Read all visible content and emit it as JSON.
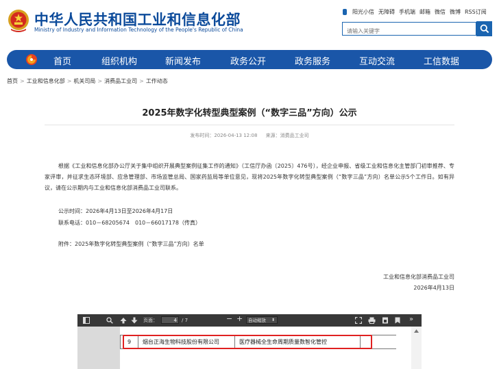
{
  "site": {
    "title_cn": "中华人民共和国工业和信息化部",
    "title_en": "Ministry of Industry and Information Technology of the People's Republic of China"
  },
  "top_links": [
    "阳光小信",
    "无障碍",
    "手机端",
    "邮箱",
    "微信",
    "微博",
    "RSS订阅"
  ],
  "search": {
    "placeholder": "请输入关键字"
  },
  "nav": {
    "items": [
      "首页",
      "组织机构",
      "新闻发布",
      "政务公开",
      "政务服务",
      "互动交流",
      "工信数据"
    ]
  },
  "breadcrumb": {
    "items": [
      "首页",
      "工业和信息化部",
      "机关司局",
      "消费品工业司",
      "工作动态"
    ],
    "separator": ">"
  },
  "article": {
    "title": "2025年数字化转型典型案例（“数字三品”方向）公示",
    "publish_time": "发布时间：2026-04-13 12:08",
    "source": "来源：消费品工业司",
    "body": "根据《工业和信息化部办公厅关于集中组织开展典型案例征集工作的通知》（工信厅办函〔2025〕476号），经企业申报、省级工业和信息化主管部门初审推荐、专家评审，并征求生态环境部、应急管理部、市场监管总局、国家药监局等单位意见，现将2025年数字化转型典型案例（“数字三品”方向）名单公示5个工作日。如有异议，请在公示期内与工业和信息化部消费品工业司联系。",
    "notice_period": "公示时间：2026年4月13日至2026年4月17日",
    "contact": "联系电话：010－68205674　010－66017178（传真）",
    "attachment": "附件：2025年数字化转型典型案例（“数字三品”方向）名单",
    "signature_org": "工业和信息化部消费品工业司",
    "signature_date": "2026年4月13日"
  },
  "pdf_viewer": {
    "page_label": "页面：",
    "page_current": "4",
    "page_total": "/ 7",
    "zoom": "自动缩放",
    "table_row": {
      "no": "9",
      "company": "烟台正海生物科技股份有限公司",
      "case": "医疗器械全生命周期质量数智化管控"
    }
  },
  "colors": {
    "brand_blue": "#1a56a8",
    "highlight_red": "#e02020"
  }
}
